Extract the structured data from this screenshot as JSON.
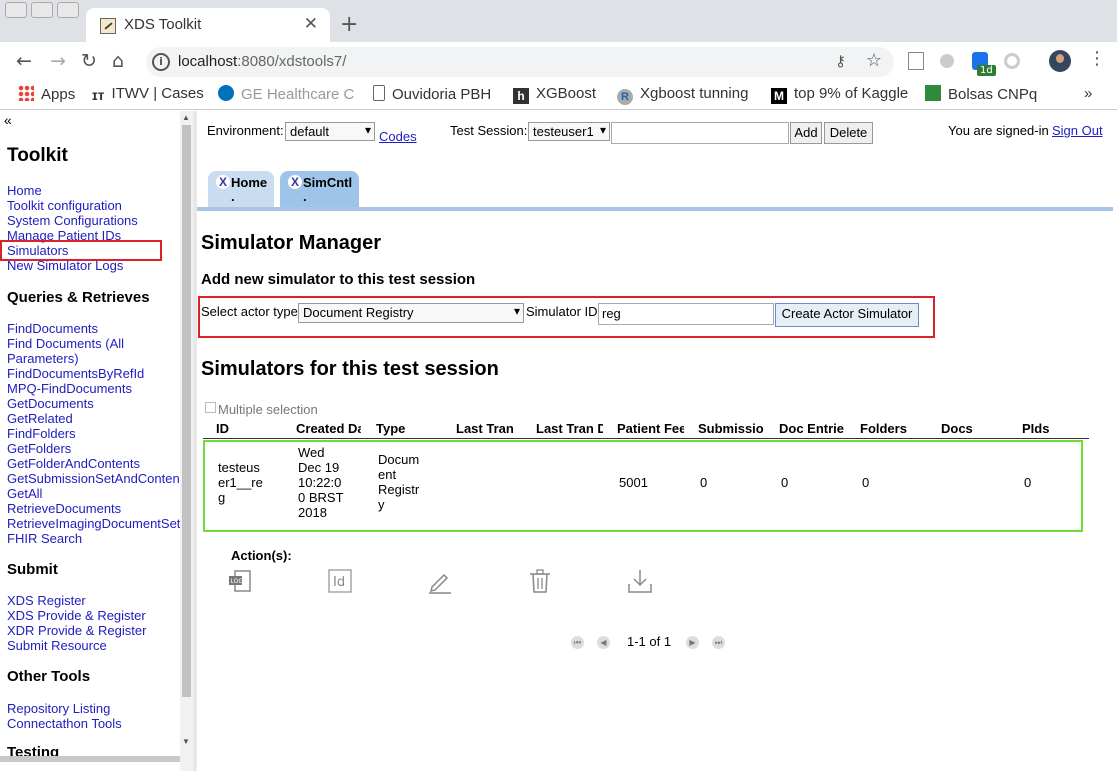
{
  "browser": {
    "tab_title": "XDS Toolkit",
    "tab_close": "✕",
    "new_tab": "+",
    "url_host": "localhost",
    "url_path": ":8080/xdstools7/",
    "ext_badge": "1d",
    "bookmarks": [
      {
        "label": "Apps",
        "icon": "apps-grid-icon"
      },
      {
        "label": "ITWV | Cases",
        "icon": "itwv-icon"
      },
      {
        "label": "GE Healthcare C",
        "icon": "ge-logo-icon"
      },
      {
        "label": "Ouvidoria PBH",
        "icon": "page-icon"
      },
      {
        "label": "XGBoost",
        "icon": "h-logo-icon"
      },
      {
        "label": "Xgboost tunning",
        "icon": "r-logo-icon"
      },
      {
        "label": "top 9% of Kaggle",
        "icon": "medium-logo-icon"
      },
      {
        "label": "Bolsas CNPq",
        "icon": "brazil-flag-icon"
      }
    ],
    "bookmarks_more": "»"
  },
  "sidebar": {
    "collapse": "«",
    "title": "Toolkit",
    "links_main": [
      "Home",
      "Toolkit configuration",
      "System Configurations",
      "Manage Patient IDs",
      "Simulators",
      "New Simulator Logs"
    ],
    "section_queries": "Queries & Retrieves",
    "links_queries": [
      "FindDocuments",
      "Find Documents (All",
      "Parameters)",
      "FindDocumentsByRefId",
      "MPQ-FindDocuments",
      "GetDocuments",
      "GetRelated",
      "FindFolders",
      "GetFolders",
      "GetFolderAndContents",
      "GetSubmissionSetAndContents",
      "GetAll",
      "RetrieveDocuments",
      "RetrieveImagingDocumentSet",
      "FHIR Search"
    ],
    "section_submit": "Submit",
    "links_submit": [
      "XDS Register",
      "XDS Provide & Register",
      "XDR Provide & Register",
      "Submit Resource"
    ],
    "section_other": "Other Tools",
    "links_other": [
      "Repository Listing",
      "Connectathon Tools"
    ],
    "section_cut": "Testing"
  },
  "header": {
    "environment_label": "Environment:",
    "environment_value": "default",
    "codes_link": "Codes",
    "test_session_label": "Test Session:",
    "test_session_value": "testeuser1",
    "test_session_input": "",
    "add_button": "Add",
    "delete_button": "Delete",
    "signed_in_text": "You are signed-in",
    "sign_out_link": "Sign Out"
  },
  "tabs": [
    {
      "label": "Home",
      "close": "X",
      "dot": "."
    },
    {
      "label": "SimCntl",
      "close": "X",
      "dot": "."
    }
  ],
  "simulator_manager": {
    "title": "Simulator Manager",
    "add_heading": "Add new simulator to this test session",
    "actor_type_label": "Select actor type",
    "actor_type_value": "Document Registry",
    "simulator_id_label": "Simulator ID",
    "simulator_id_value": "reg",
    "create_button": "Create Actor Simulator",
    "list_heading": "Simulators for this test session",
    "multiple_selection": "Multiple selection",
    "columns": [
      "ID",
      "Created Da",
      "Type",
      "Last Tran",
      "Last Tran D",
      "Patient Fee",
      "Submissio",
      "Doc Entrie",
      "Folders",
      "Docs",
      "PIds"
    ],
    "row": {
      "id": [
        "testeus",
        "er1__re",
        "g"
      ],
      "created": [
        "Wed",
        "Dec 19",
        "10:22:0",
        "0 BRST",
        "2018"
      ],
      "type": [
        "Docum",
        "ent",
        "Registr",
        "y"
      ],
      "patient_feed": "5001",
      "submissions": "0",
      "doc_entries": "0",
      "folders": "0",
      "pids": "0"
    },
    "actions_label": "Action(s):",
    "action_icons": [
      "log-icon",
      "id-icon",
      "edit-pencil-icon",
      "trash-icon",
      "download-icon"
    ],
    "pager_text": "1-1 of 1"
  },
  "colors": {
    "highlight_red": "#d9232c",
    "row_green": "#6fdc33",
    "tab_blue": "#aac6e6",
    "link_blue": "#2020c0"
  }
}
